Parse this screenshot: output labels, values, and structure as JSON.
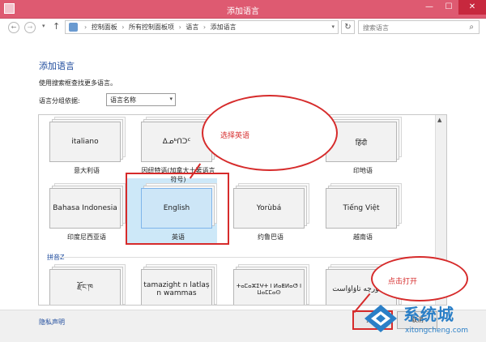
{
  "window": {
    "title": "添加语言",
    "minimize": "—",
    "maximize": "☐",
    "close": "✕"
  },
  "nav": {
    "back": "←",
    "forward": "→",
    "recent": "▾",
    "up": "↑",
    "breadcrumbs": [
      "控制面板",
      "所有控制面板项",
      "语言",
      "添加语言"
    ],
    "separator": "›",
    "refresh": "↻",
    "search_placeholder": "搜索语言",
    "search_icon": "⌕"
  },
  "content": {
    "title": "添加语言",
    "intro": "使用搜索框查找更多语言。",
    "group_by_label": "语言分组依据:",
    "group_by_value": "语言名称",
    "section_pinyin": "拼音Z"
  },
  "tiles": [
    {
      "name": "italiano",
      "label": "意大利语"
    },
    {
      "name": "ᐃᓄᒃᑎᑐᑦ",
      "label": "因纽特语(加拿大土著语言符号)"
    },
    {
      "name": "",
      "label": ""
    },
    {
      "name": "हिंदी",
      "label": "印地语"
    },
    {
      "name": "Bahasa Indonesia",
      "label": "印度尼西亚语"
    },
    {
      "name": "English",
      "label": "英语",
      "selected": true
    },
    {
      "name": "Yorùbá",
      "label": "约鲁巴语"
    },
    {
      "name": "Tiếng Việt",
      "label": "越南语"
    },
    {
      "name": "རྫོང་ཁ",
      "label": ""
    },
    {
      "name": "tamazight n latlaṣ n wammas",
      "label": ""
    },
    {
      "name": "ⵜⴰⵎⴰⵣⵉⵖⵜ ⵏ ⵍⴰⵟⵍⴰⵚ ⵏ ⵡⴰⵎⵎⴰⵙ",
      "label": ""
    },
    {
      "name": "ئۇيغۇرچە تاۋاۋاست",
      "label": ""
    }
  ],
  "annotations": {
    "bubble_select": "选择英语",
    "bubble_open": "点击打开"
  },
  "footer": {
    "privacy": "隐私声明",
    "open_button": "打开",
    "cancel_button": "取消"
  },
  "watermark": {
    "brand": "系统城",
    "site": "xitongcheng.com"
  },
  "colors": {
    "titlebar": "#de5a71",
    "accent_red": "#d62b2b",
    "selected_tile": "#cde8f8",
    "link_blue": "#1d4a9c"
  }
}
